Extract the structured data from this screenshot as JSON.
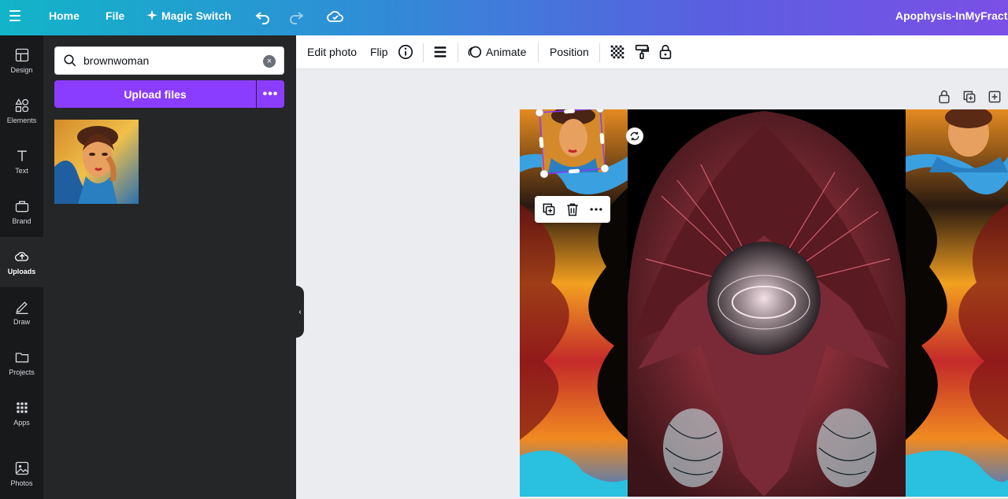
{
  "topbar": {
    "home": "Home",
    "file": "File",
    "magic_switch": "Magic Switch",
    "doc_title": "Apophysis-InMyFractalU"
  },
  "rail": {
    "items": [
      {
        "label": "Design"
      },
      {
        "label": "Elements"
      },
      {
        "label": "Text"
      },
      {
        "label": "Brand"
      },
      {
        "label": "Uploads"
      },
      {
        "label": "Draw"
      },
      {
        "label": "Projects"
      },
      {
        "label": "Apps"
      },
      {
        "label": "Photos"
      }
    ]
  },
  "panel": {
    "search_value": "brownwoman",
    "upload_label": "Upload files",
    "more_label": "•••"
  },
  "toolbar": {
    "edit_photo": "Edit photo",
    "flip": "Flip",
    "animate": "Animate",
    "position": "Position"
  },
  "colors": {
    "accent": "#8b3dff",
    "rail_bg": "#18191b",
    "panel_bg": "#252627"
  }
}
